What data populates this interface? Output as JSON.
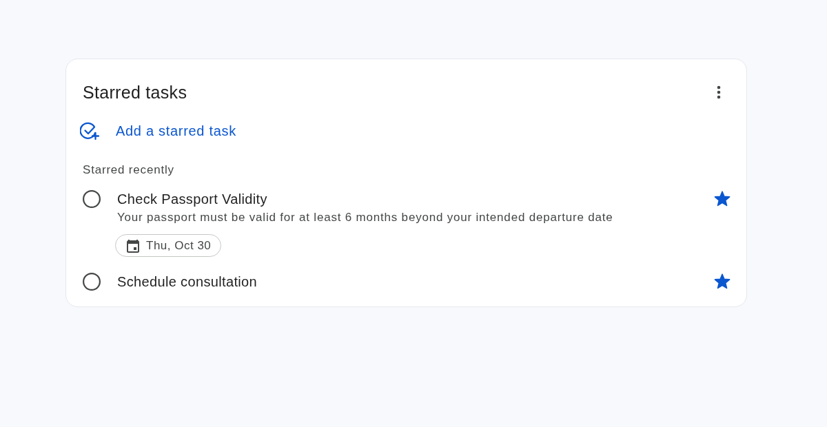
{
  "card": {
    "title": "Starred tasks",
    "add_task": {
      "label": "Add a starred task"
    },
    "section_label": "Starred recently",
    "tasks": [
      {
        "title": "Check Passport Validity",
        "description": "Your passport must be valid for at least 6 months beyond your intended departure date",
        "due": "Thu, Oct 30",
        "completed": false,
        "starred": true
      },
      {
        "title": "Schedule consultation",
        "completed": false,
        "starred": true
      }
    ]
  }
}
